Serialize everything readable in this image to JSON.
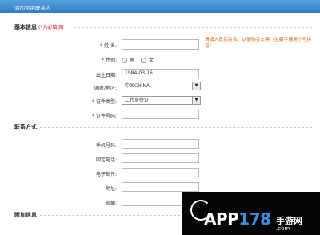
{
  "title": "添加常用联系人",
  "basic": {
    "heading": "基本信息",
    "required_note": "(*为必填项)",
    "name_label": "姓 名:",
    "name_value": "",
    "hint": "请填入真实姓名，以便购买车票（生僻字请用小写拼音）",
    "gender_label": "性别:",
    "gender_male": "男",
    "gender_female": "女",
    "birth_label": "出生日期:",
    "birth_value": "1984-03-16",
    "country_label": "国家/地区:",
    "country_value": "中国CHINA",
    "idtype_label": "证件类型:",
    "idtype_value": "二代身份证",
    "idnum_label": "证件号码:",
    "idnum_value": ""
  },
  "contact": {
    "heading": "联系方式",
    "mobile_label": "手机号码:",
    "phone_label": "固定电话:",
    "email_label": "电子邮件:",
    "address_label": "地址:",
    "zip_label": "邮编:"
  },
  "extra": {
    "heading": "附加信息"
  },
  "watermark": {
    "app": "APP",
    "num": "178",
    "cn": "手游网",
    "com": ".com"
  },
  "colors": {
    "header": "#2f7fc4",
    "required": "#d40000",
    "hint": "#e06000"
  }
}
